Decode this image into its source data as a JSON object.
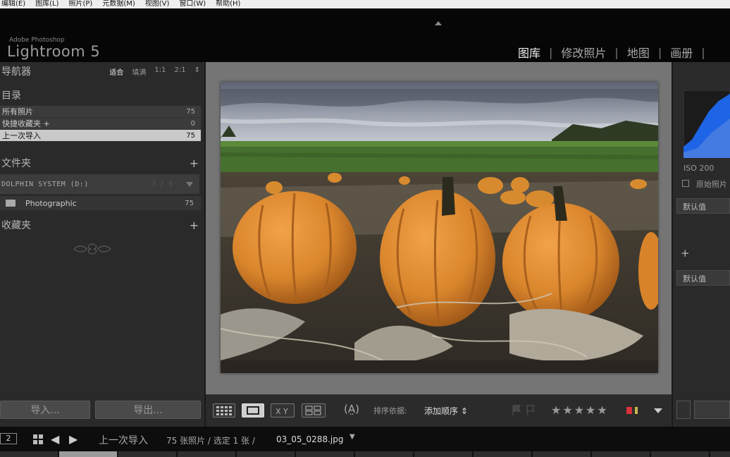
{
  "menubar": [
    "编辑(E)",
    "图库(L)",
    "照片(P)",
    "元数据(M)",
    "视图(V)",
    "窗口(W)",
    "帮助(H)"
  ],
  "identity": {
    "small": "Adobe Photoshop",
    "title": "Lightroom 5"
  },
  "modules": [
    {
      "label": "图库",
      "active": true
    },
    {
      "label": "修改照片",
      "active": false
    },
    {
      "label": "地图",
      "active": false
    },
    {
      "label": "画册",
      "active": false
    }
  ],
  "navigator": {
    "title": "导航器",
    "opts": [
      "适合",
      "填满",
      "1:1",
      "2:1"
    ],
    "dropdown": "⇕"
  },
  "catalog": {
    "title": "目录",
    "items": [
      {
        "label": "所有照片",
        "count": "75"
      },
      {
        "label": "快捷收藏夹 +",
        "count": "0"
      },
      {
        "label": "上一次导入",
        "count": "75"
      }
    ]
  },
  "folders": {
    "title": "文件夹",
    "plus": "+",
    "volume": "DOLPHIN SYSTEM (D:)",
    "volume_count": "3 / 5",
    "folder": "Photographic",
    "folder_count": "75"
  },
  "collections": {
    "title": "收藏夹",
    "plus": "+"
  },
  "buttons": {
    "import": "导入...",
    "export": "导出..."
  },
  "toolbar": {
    "sort_label": "排序依据:",
    "sort_value": "添加顺序 ⇕",
    "stars": "★★★★★",
    "xy": "X Y",
    "spray": "(A̤)"
  },
  "colors": {
    "label_red": "#d8323c",
    "label_yellow": "#c8b84a",
    "histogram": "#1e64e6"
  },
  "right": {
    "iso": "ISO 200",
    "original": "原始照片",
    "preset1": "默认值",
    "plus": "+",
    "preset2": "默认值"
  },
  "filmstrip": {
    "num": "2",
    "source": "上一次导入",
    "info": "75 张照片 / 选定 1 张 /",
    "filename": "03_05_0288.jpg",
    "dropdown": "▼"
  }
}
